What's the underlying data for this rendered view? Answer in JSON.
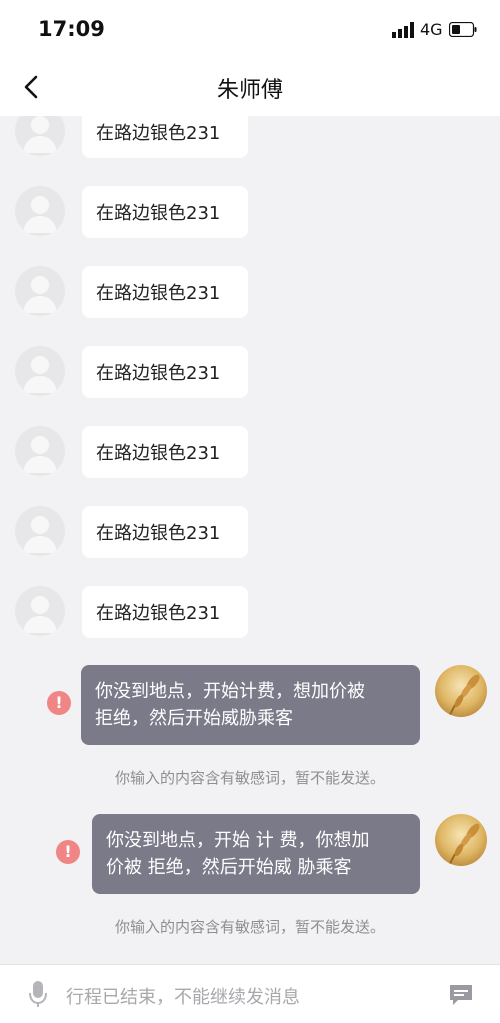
{
  "status": {
    "time": "17:09",
    "network": "4G"
  },
  "header": {
    "title": "朱师傅"
  },
  "messages_in": [
    "在路边银色231",
    "在路边银色231",
    "在路边银色231",
    "在路边银色231",
    "在路边银色231",
    "在路边银色231",
    "在路边银色231"
  ],
  "messages_out": [
    {
      "line1": "你没到地点，开始计费，想加价被",
      "line2": "拒绝，然后开始威胁乘客"
    },
    {
      "line1": "你没到地点，开始 计 费，你想加",
      "line2": "价被 拒绝，然后开始威 胁乘客"
    }
  ],
  "notices": [
    "你输入的内容含有敏感词，暂不能发送。",
    "你输入的内容含有敏感词，暂不能发送。"
  ],
  "input": {
    "placeholder": "行程已结束，不能继续发消息"
  },
  "colors": {
    "outgoing_bubble": "#7b7a89",
    "warning": "#f08585",
    "background": "#f2f2f4"
  }
}
